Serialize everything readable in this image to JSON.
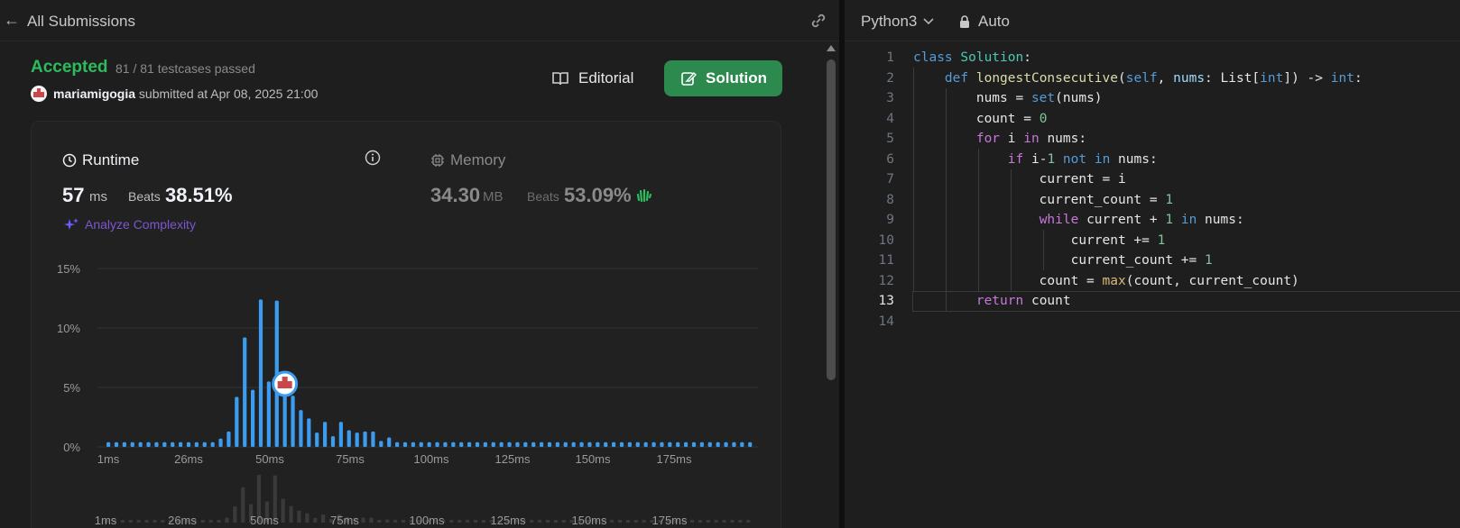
{
  "left": {
    "back_label": "All Submissions",
    "status": "Accepted",
    "testcases": "81 / 81 testcases passed",
    "username": "mariamigogia",
    "submitted_text": "submitted at Apr 08, 2025 21:00",
    "editorial_label": "Editorial",
    "solution_label": "Solution",
    "runtime": {
      "title": "Runtime",
      "value": "57",
      "unit": "ms",
      "beats_label": "Beats",
      "beats_value": "38.51%",
      "analyze_label": "Analyze Complexity"
    },
    "memory": {
      "title": "Memory",
      "value": "34.30",
      "unit": "MB",
      "beats_label": "Beats",
      "beats_value": "53.09%"
    }
  },
  "colors": {
    "accent_green": "#2cbb5d",
    "button_green": "#2d8a4e",
    "bar_blue": "#3b9cf0",
    "analyze_purple": "#7a57d1"
  },
  "chart_data": {
    "type": "bar",
    "ylabel": "",
    "xlabel": "",
    "y_ticks": [
      "15%",
      "10%",
      "5%",
      "0%"
    ],
    "y_tick_values": [
      15,
      10,
      5,
      0
    ],
    "ylim": [
      0,
      15
    ],
    "x_ticks": [
      "1ms",
      "26ms",
      "50ms",
      "75ms",
      "100ms",
      "125ms",
      "150ms",
      "175ms"
    ],
    "grid": true,
    "highlight_bar_index": 22,
    "values": [
      0.4,
      0.4,
      0.4,
      0.4,
      0.4,
      0.4,
      0.4,
      0.4,
      0.4,
      0.4,
      0.4,
      0.4,
      0.4,
      0.4,
      0.7,
      1.3,
      4.2,
      9.2,
      4.8,
      12.4,
      5.5,
      12.3,
      6.2,
      4.3,
      3.1,
      2.4,
      1.2,
      2.1,
      0.9,
      2.1,
      1.4,
      1.2,
      1.3,
      1.3,
      0.5,
      0.8,
      0.4,
      0.4,
      0.4,
      0.4,
      0.4,
      0.4,
      0.4,
      0.4,
      0.4,
      0.4,
      0.4,
      0.4,
      0.4,
      0.4,
      0.4,
      0.4,
      0.4,
      0.4,
      0.4,
      0.4,
      0.4,
      0.4,
      0.4,
      0.4,
      0.4,
      0.4,
      0.4,
      0.4,
      0.4,
      0.4,
      0.4,
      0.4,
      0.4,
      0.4,
      0.4,
      0.4,
      0.4,
      0.4,
      0.4,
      0.4,
      0.4,
      0.4,
      0.4,
      0.4,
      0.4
    ],
    "mini_x_ticks": [
      "1ms",
      "26ms",
      "50ms",
      "75ms",
      "100ms",
      "125ms",
      "150ms",
      "175ms"
    ]
  },
  "editor": {
    "language": "Python3",
    "mode": "Auto",
    "current_line": 13,
    "lines": [
      "class Solution:",
      "    def longestConsecutive(self, nums: List[int]) -> int:",
      "        nums = set(nums)",
      "        count = 0",
      "        for i in nums:",
      "            if i-1 not in nums:",
      "                current = i",
      "                current_count = 1",
      "                while current + 1 in nums:",
      "                    current += 1",
      "                    current_count += 1",
      "                count = max(count, current_count)",
      "        return count",
      ""
    ]
  }
}
